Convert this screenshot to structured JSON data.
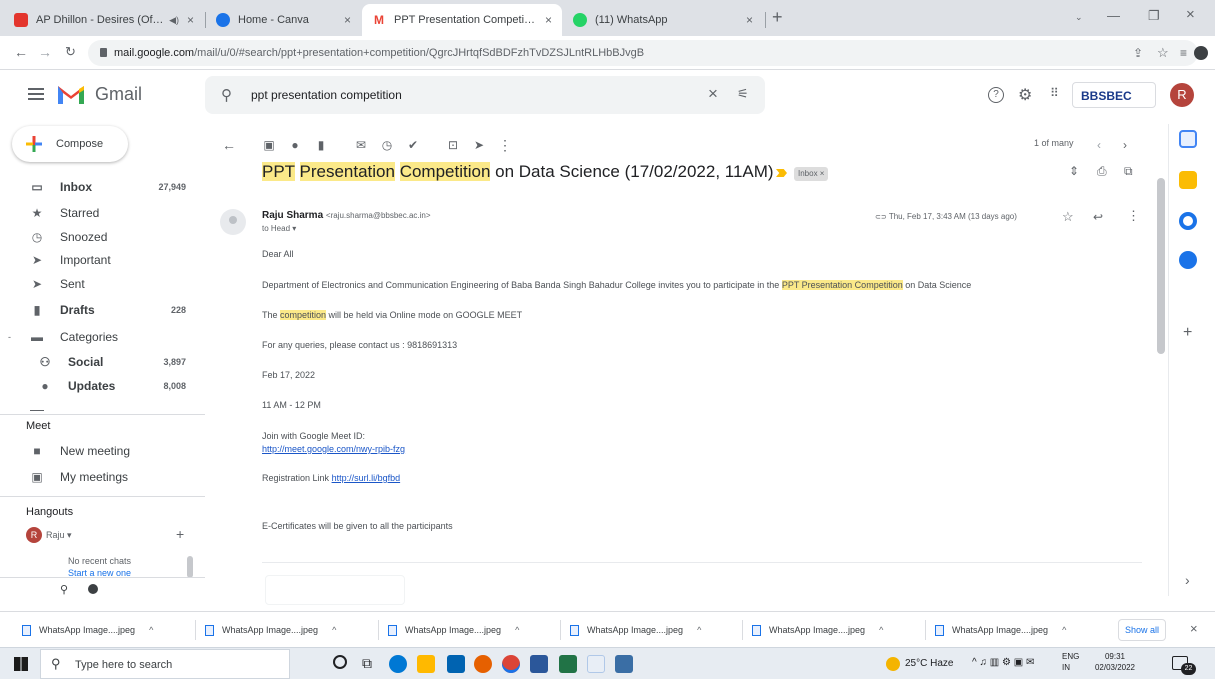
{
  "browser": {
    "tabs": [
      {
        "title": "AP Dhillon - Desires (Officia",
        "active": false,
        "color": "#e3352d"
      },
      {
        "title": "Home - Canva",
        "active": false,
        "color": "#1a73e8"
      },
      {
        "title": "PPT Presentation Competition o",
        "active": true,
        "color": "#ea4335"
      },
      {
        "title": "(11) WhatsApp",
        "active": false,
        "color": "#25d366"
      }
    ],
    "new_tab_label": "+",
    "url_host": "mail.google.com",
    "url_path": "/mail/u/0/#search/ppt+presentation+competition/QgrcJHrtqfSdBDFzhTvDZSJLntRLHbBJvgB"
  },
  "gmail": {
    "logo_text": "Gmail",
    "search_query": "ppt presentation competition",
    "org_logo_text": "BBSBEC",
    "avatar_letter": "R",
    "compose_label": "Compose",
    "nav": [
      {
        "label": "Inbox",
        "count": "27,949",
        "bold": true,
        "icon": "inbox-icon"
      },
      {
        "label": "Starred",
        "count": "",
        "bold": false,
        "icon": "star-icon"
      },
      {
        "label": "Snoozed",
        "count": "",
        "bold": false,
        "icon": "clock-icon"
      },
      {
        "label": "Important",
        "count": "",
        "bold": false,
        "icon": "important-icon"
      },
      {
        "label": "Sent",
        "count": "",
        "bold": false,
        "icon": "send-icon"
      },
      {
        "label": "Drafts",
        "count": "228",
        "bold": true,
        "icon": "draft-icon"
      },
      {
        "label": "Categories",
        "count": "",
        "bold": false,
        "icon": "label-icon"
      },
      {
        "label": "Social",
        "count": "3,897",
        "bold": true,
        "icon": "people-icon"
      },
      {
        "label": "Updates",
        "count": "8,008",
        "bold": true,
        "icon": "info-icon"
      }
    ],
    "meet": {
      "heading": "Meet",
      "items": [
        "New meeting",
        "My meetings"
      ]
    },
    "hangouts": {
      "heading": "Hangouts",
      "user": "Raju",
      "no_chats": "No recent chats",
      "start_chat": "Start a new one"
    },
    "pager": "1 of many",
    "email": {
      "subject_parts": [
        {
          "text": "PPT",
          "hl": true
        },
        {
          "text": " ",
          "hl": false
        },
        {
          "text": "Presentation",
          "hl": true
        },
        {
          "text": " ",
          "hl": false
        },
        {
          "text": "Competition",
          "hl": true
        },
        {
          "text": " on Data Science (17/02/2022, 11AM)",
          "hl": false
        }
      ],
      "label_chip": "Inbox ×",
      "sender_name": "Raju Sharma",
      "sender_email": "<raju.sharma@bbsbec.ac.in>",
      "to": "to Head ▾",
      "date": "Thu, Feb 17, 3:43 AM (13 days ago)",
      "greeting": "Dear All",
      "line1_before": "Department of Electronics and Communication Engineering of Baba Banda Singh Bahadur College invites you to participate in the ",
      "line1_hl": "PPT Presentation Competition",
      "line1_after": " on Data Science",
      "line2_before": "The ",
      "line2_hl": "competition",
      "line2_after": " will be held via Online mode on GOOGLE MEET",
      "line3": "For any queries, please contact us : 9818691313",
      "line4": "Feb 17, 2022",
      "line5": "11 AM - 12 PM",
      "line6": "Join with Google Meet ID:",
      "meet_link": "http://meet.google.com/nwy-rpib-fzg",
      "reg_label": "Registration Link",
      "reg_link": "http://surl.li/bgfbd",
      "line8": "E-Certificates will be given to all the participants"
    }
  },
  "downloads": {
    "items": [
      "WhatsApp Image....jpeg",
      "WhatsApp Image....jpeg",
      "WhatsApp Image....jpeg",
      "WhatsApp Image....jpeg",
      "WhatsApp Image....jpeg",
      "WhatsApp Image....jpeg"
    ],
    "show_all": "Show all"
  },
  "taskbar": {
    "search_placeholder": "Type here to search",
    "weather": "25°C  Haze",
    "lang1": "ENG",
    "lang2": "IN",
    "time": "09:31",
    "date": "02/03/2022",
    "notif_count": "22"
  }
}
